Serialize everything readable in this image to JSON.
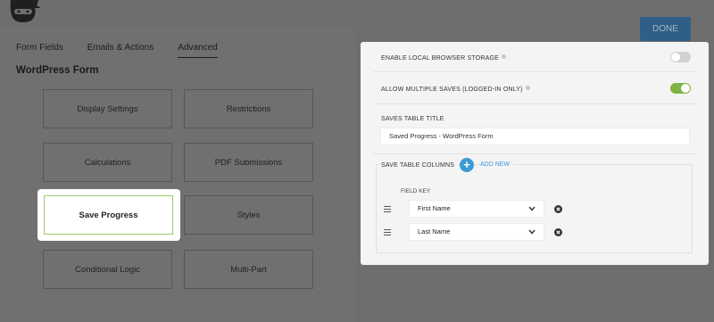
{
  "header": {
    "done_label": "DONE"
  },
  "tabs": [
    {
      "label": "Form Fields",
      "active": false
    },
    {
      "label": "Emails & Actions",
      "active": false
    },
    {
      "label": "Advanced",
      "active": true
    }
  ],
  "form_title": "WordPress Form",
  "tiles": [
    {
      "label": "Display Settings",
      "selected": false
    },
    {
      "label": "Restrictions",
      "selected": false
    },
    {
      "label": "Calculations",
      "selected": false
    },
    {
      "label": "PDF Submissions",
      "selected": false
    },
    {
      "label": "Save Progress",
      "selected": true
    },
    {
      "label": "Styles",
      "selected": false
    },
    {
      "label": "Conditional Logic",
      "selected": false
    },
    {
      "label": "Multi-Part",
      "selected": false
    }
  ],
  "drawer": {
    "local_storage": {
      "label": "ENABLE LOCAL BROWSER STORAGE",
      "enabled": false
    },
    "multiple_saves": {
      "label": "ALLOW MULTIPLE SAVES (LOGGED-IN ONLY)",
      "enabled": true
    },
    "saves_table_title": {
      "label": "SAVES TABLE TITLE",
      "value": "Saved Progress - WordPress Form"
    },
    "columns": {
      "label": "SAVE TABLE COLUMNS",
      "add_new": "ADD NEW",
      "field_key_header": "FIELD KEY",
      "rows": [
        {
          "value": "First Name"
        },
        {
          "value": "Last Name"
        }
      ]
    }
  },
  "colors": {
    "accent_green": "#7cb342",
    "accent_blue": "#3d9ad6",
    "done_button": "#2f5f86"
  }
}
